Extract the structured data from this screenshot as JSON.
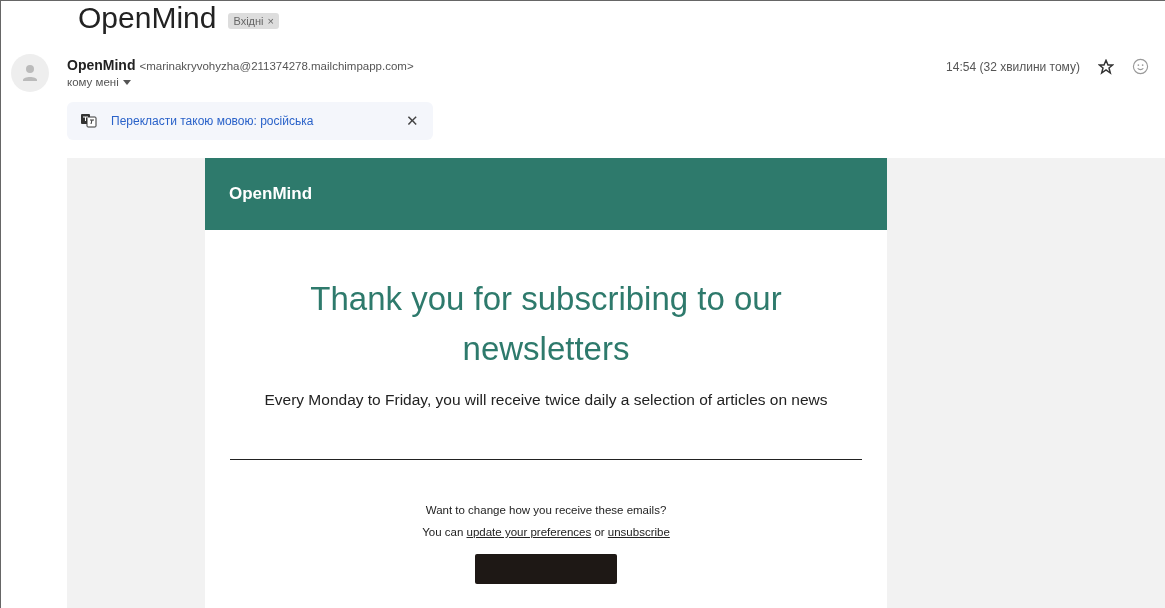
{
  "subject": {
    "title": "OpenMind",
    "label": "Вхідні",
    "label_close": "×"
  },
  "sender": {
    "name": "OpenMind",
    "address": "<marinakryvohyzha@211374278.mailchimpapp.com>",
    "recipient": "кому мені",
    "time": "14:54 (32 хвилини тому)",
    "starred": false
  },
  "translate_bar": {
    "text": "Перекласти такою мовою: російська",
    "close": "✕"
  },
  "email": {
    "brand": "OpenMind",
    "heading": "Thank you for subscribing to our newsletters",
    "body": "Every Monday to Friday, you will receive twice daily a selection of articles on news",
    "footer_question": "Want to change how you receive these emails?",
    "footer_prefix": "You can ",
    "footer_link_1": "update your preferences",
    "footer_middle": " or ",
    "footer_link_2": "unsubscribe"
  }
}
